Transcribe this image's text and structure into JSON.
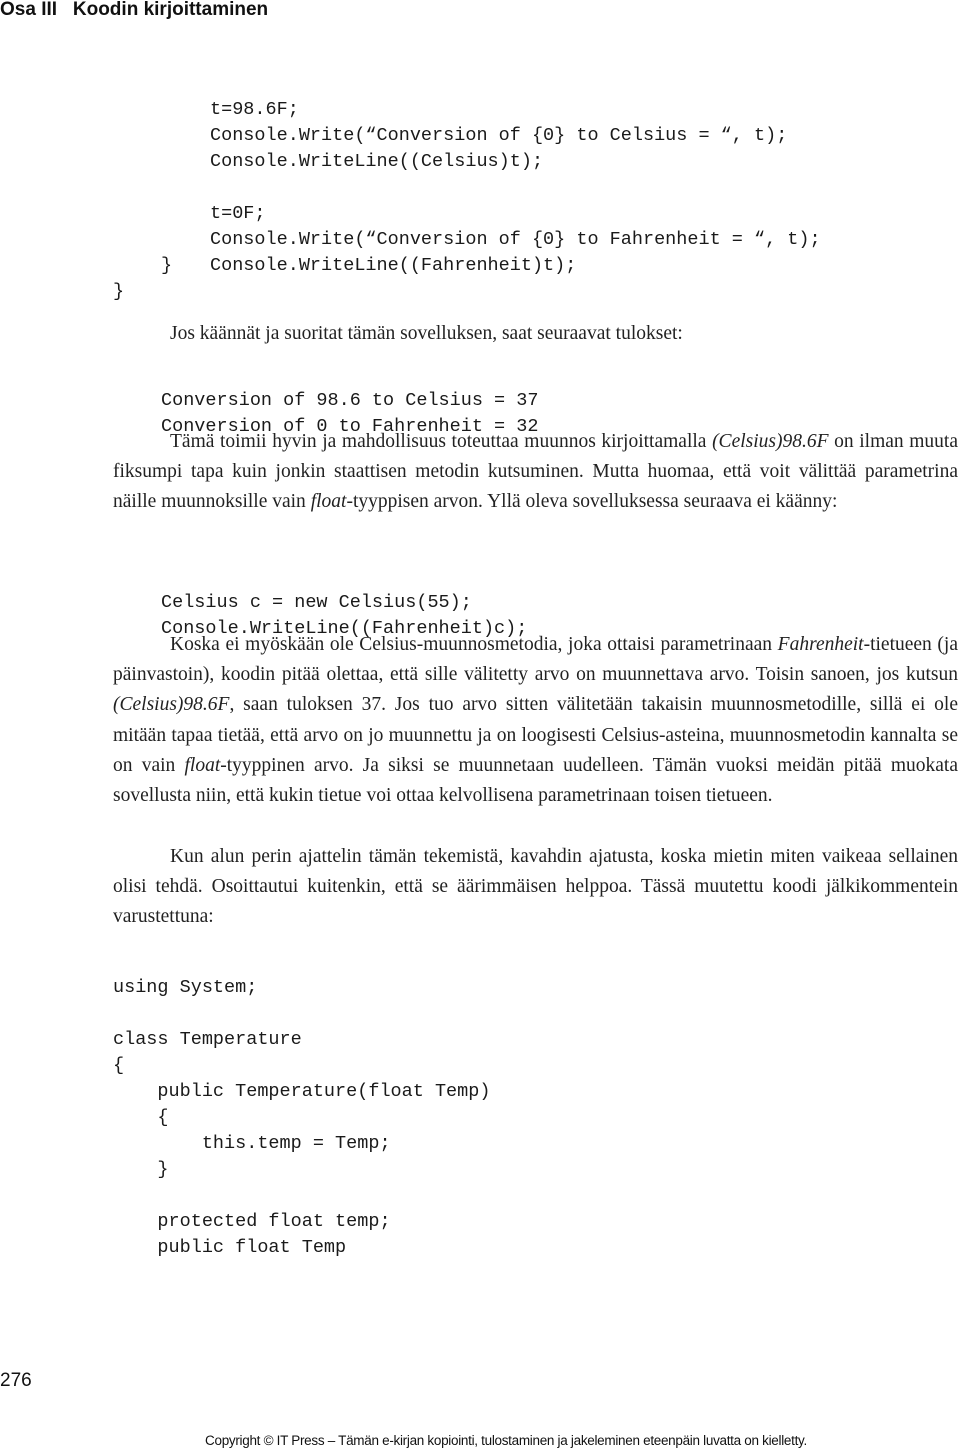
{
  "header": {
    "part": "Osa III",
    "title": "Koodin kirjoittaminen"
  },
  "code_block_1": [
    "t=98.6F;",
    "Console.Write(“Conversion of {0} to Celsius = “, t);",
    "Console.WriteLine((Celsius)t);",
    "",
    "t=0F;",
    "Console.Write(“Conversion of {0} to Fahrenheit = “, t);",
    "Console.WriteLine((Fahrenheit)t);"
  ],
  "closing_braces": [
    "}",
    "}"
  ],
  "intro_output": "Jos käännät ja suoritat tämän sovelluksen, saat seuraavat tulokset:",
  "output_lines": [
    "Conversion of 98.6 to Celsius = 37",
    "Conversion of 0 to Fahrenheit = 32"
  ],
  "paragraph_1": {
    "part1": "Tämä toimii hyvin ja mahdollisuus toteuttaa muunnos kirjoittamalla ",
    "italic1": "(Celsius)98.6F",
    "part2": " on ilman muuta fiksumpi tapa kuin jonkin staattisen metodin kutsuminen. Mutta huomaa, että voit välittää parametrina näille muunnoksille vain ",
    "italic2": "float",
    "part3": "-tyyppisen arvon. Yllä oleva sovelluksessa seuraava ei käänny:"
  },
  "code_block_2": [
    "Celsius c = new Celsius(55);",
    "Console.WriteLine((Fahrenheit)c);"
  ],
  "paragraph_2": {
    "part1": "Koska ei myöskään ole Celsius-muunnosmetodia, joka ottaisi parametrinaan ",
    "italic1": "Fahrenheit",
    "part2": "-tietueen (ja päinvastoin), koodin pitää olettaa, että sille välitetty arvo on muunnettava arvo. Toisin sanoen, jos kutsun ",
    "italic2": "(Celsius)98.6F",
    "part3": ", saan tuloksen 37. Jos tuo arvo sitten välitetään takaisin muunnosmetodille, sillä ei ole mitään tapaa tietää, että arvo on jo muunnettu ja on loogisesti Celsius-asteina, muunnosmetodin kannalta se on vain ",
    "italic3": "float",
    "part4": "-tyyppinen arvo. Ja siksi se muunnetaan uudelleen. Tämän vuoksi meidän pitää muokata sovellusta niin, että kukin tietue voi ottaa kelvollisena parametrinaan toisen tietueen."
  },
  "paragraph_3": "Kun alun perin ajattelin tämän tekemistä, kavahdin ajatusta, koska mietin miten vaikeaa sellainen olisi tehdä. Osoittautui kuitenkin, että se äärimmäisen helppoa. Tässä muutettu koodi jälkikommentein varustettuna:",
  "code_block_3": [
    "using System;",
    "",
    "class Temperature",
    "{",
    "    public Temperature(float Temp)",
    "    {",
    "        this.temp = Temp;",
    "    }",
    "",
    "    protected float temp;",
    "    public float Temp"
  ],
  "page_number": "276",
  "footer": "Copyright © IT Press – Tämän e-kirjan kopiointi, tulostaminen ja jakeleminen eteenpäin luvatta on kielletty."
}
